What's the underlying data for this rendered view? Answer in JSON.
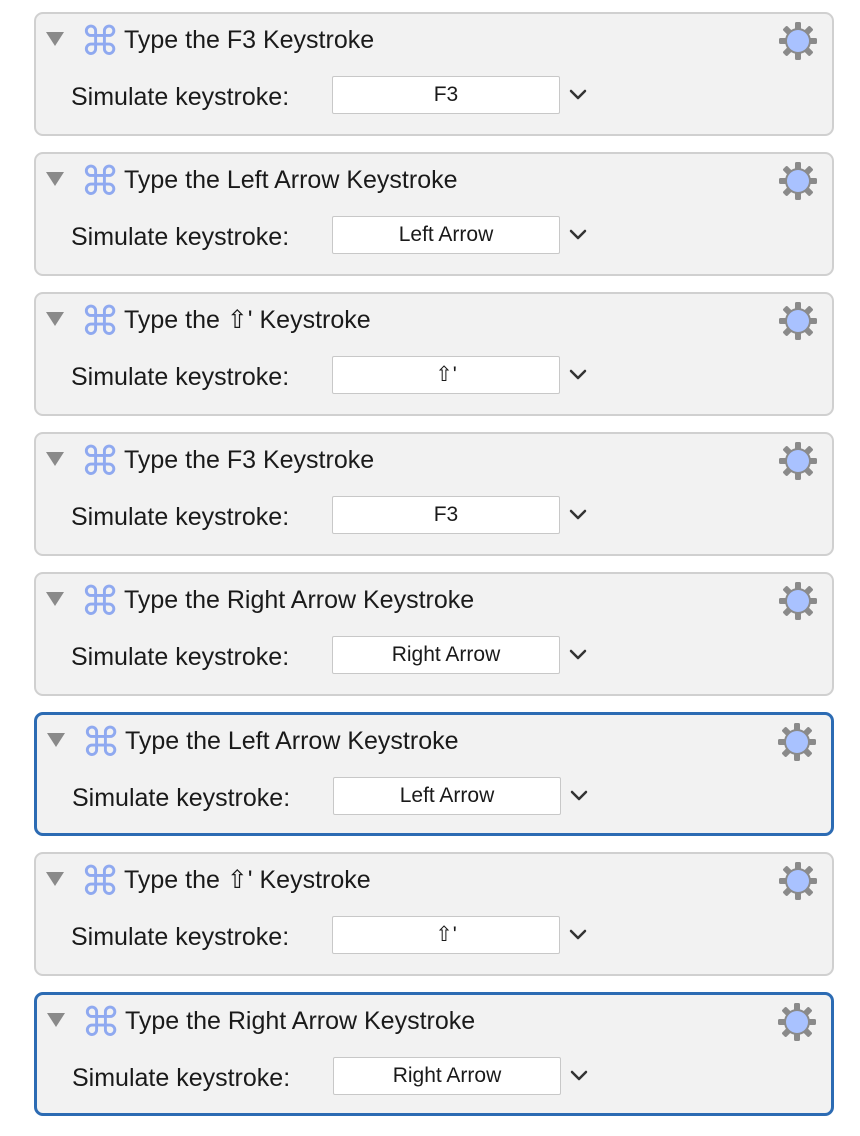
{
  "actions": [
    {
      "title": "Type the F3 Keystroke",
      "field_label": "Simulate keystroke:",
      "keystroke": "F3",
      "selected": false
    },
    {
      "title": "Type the Left Arrow Keystroke",
      "field_label": "Simulate keystroke:",
      "keystroke": "Left Arrow",
      "selected": false
    },
    {
      "title": "Type the ⇧' Keystroke",
      "field_label": "Simulate keystroke:",
      "keystroke": "⇧'",
      "selected": false
    },
    {
      "title": "Type the F3 Keystroke",
      "field_label": "Simulate keystroke:",
      "keystroke": "F3",
      "selected": false
    },
    {
      "title": "Type the Right Arrow Keystroke",
      "field_label": "Simulate keystroke:",
      "keystroke": "Right Arrow",
      "selected": false
    },
    {
      "title": "Type the Left Arrow Keystroke",
      "field_label": "Simulate keystroke:",
      "keystroke": "Left Arrow",
      "selected": true
    },
    {
      "title": "Type the ⇧' Keystroke",
      "field_label": "Simulate keystroke:",
      "keystroke": "⇧'",
      "selected": false
    },
    {
      "title": "Type the Right Arrow Keystroke",
      "field_label": "Simulate keystroke:",
      "keystroke": "Right Arrow",
      "selected": true
    }
  ],
  "icons": {
    "action_icon": "command-key-icon",
    "disclosure": "disclosure-triangle-icon",
    "gear": "gear-icon",
    "dropdown": "chevron-down-icon"
  },
  "colors": {
    "selected_border": "#2c6bb3",
    "command_icon": "#8fa9f0",
    "gear_fill": "#a9c2ff",
    "gear_outline": "#8a8a8a"
  }
}
